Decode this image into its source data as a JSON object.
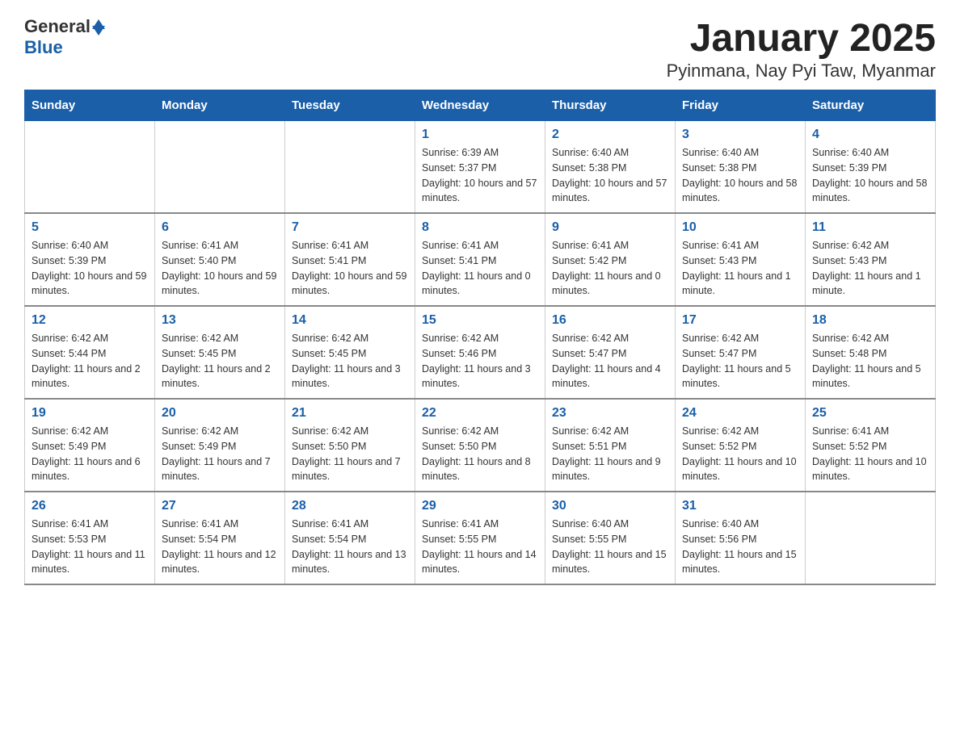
{
  "logo": {
    "text_general": "General",
    "text_blue": "Blue"
  },
  "title": "January 2025",
  "subtitle": "Pyinmana, Nay Pyi Taw, Myanmar",
  "days_of_week": [
    "Sunday",
    "Monday",
    "Tuesday",
    "Wednesday",
    "Thursday",
    "Friday",
    "Saturday"
  ],
  "weeks": [
    [
      {
        "day": "",
        "info": ""
      },
      {
        "day": "",
        "info": ""
      },
      {
        "day": "",
        "info": ""
      },
      {
        "day": "1",
        "info": "Sunrise: 6:39 AM\nSunset: 5:37 PM\nDaylight: 10 hours and 57 minutes."
      },
      {
        "day": "2",
        "info": "Sunrise: 6:40 AM\nSunset: 5:38 PM\nDaylight: 10 hours and 57 minutes."
      },
      {
        "day": "3",
        "info": "Sunrise: 6:40 AM\nSunset: 5:38 PM\nDaylight: 10 hours and 58 minutes."
      },
      {
        "day": "4",
        "info": "Sunrise: 6:40 AM\nSunset: 5:39 PM\nDaylight: 10 hours and 58 minutes."
      }
    ],
    [
      {
        "day": "5",
        "info": "Sunrise: 6:40 AM\nSunset: 5:39 PM\nDaylight: 10 hours and 59 minutes."
      },
      {
        "day": "6",
        "info": "Sunrise: 6:41 AM\nSunset: 5:40 PM\nDaylight: 10 hours and 59 minutes."
      },
      {
        "day": "7",
        "info": "Sunrise: 6:41 AM\nSunset: 5:41 PM\nDaylight: 10 hours and 59 minutes."
      },
      {
        "day": "8",
        "info": "Sunrise: 6:41 AM\nSunset: 5:41 PM\nDaylight: 11 hours and 0 minutes."
      },
      {
        "day": "9",
        "info": "Sunrise: 6:41 AM\nSunset: 5:42 PM\nDaylight: 11 hours and 0 minutes."
      },
      {
        "day": "10",
        "info": "Sunrise: 6:41 AM\nSunset: 5:43 PM\nDaylight: 11 hours and 1 minute."
      },
      {
        "day": "11",
        "info": "Sunrise: 6:42 AM\nSunset: 5:43 PM\nDaylight: 11 hours and 1 minute."
      }
    ],
    [
      {
        "day": "12",
        "info": "Sunrise: 6:42 AM\nSunset: 5:44 PM\nDaylight: 11 hours and 2 minutes."
      },
      {
        "day": "13",
        "info": "Sunrise: 6:42 AM\nSunset: 5:45 PM\nDaylight: 11 hours and 2 minutes."
      },
      {
        "day": "14",
        "info": "Sunrise: 6:42 AM\nSunset: 5:45 PM\nDaylight: 11 hours and 3 minutes."
      },
      {
        "day": "15",
        "info": "Sunrise: 6:42 AM\nSunset: 5:46 PM\nDaylight: 11 hours and 3 minutes."
      },
      {
        "day": "16",
        "info": "Sunrise: 6:42 AM\nSunset: 5:47 PM\nDaylight: 11 hours and 4 minutes."
      },
      {
        "day": "17",
        "info": "Sunrise: 6:42 AM\nSunset: 5:47 PM\nDaylight: 11 hours and 5 minutes."
      },
      {
        "day": "18",
        "info": "Sunrise: 6:42 AM\nSunset: 5:48 PM\nDaylight: 11 hours and 5 minutes."
      }
    ],
    [
      {
        "day": "19",
        "info": "Sunrise: 6:42 AM\nSunset: 5:49 PM\nDaylight: 11 hours and 6 minutes."
      },
      {
        "day": "20",
        "info": "Sunrise: 6:42 AM\nSunset: 5:49 PM\nDaylight: 11 hours and 7 minutes."
      },
      {
        "day": "21",
        "info": "Sunrise: 6:42 AM\nSunset: 5:50 PM\nDaylight: 11 hours and 7 minutes."
      },
      {
        "day": "22",
        "info": "Sunrise: 6:42 AM\nSunset: 5:50 PM\nDaylight: 11 hours and 8 minutes."
      },
      {
        "day": "23",
        "info": "Sunrise: 6:42 AM\nSunset: 5:51 PM\nDaylight: 11 hours and 9 minutes."
      },
      {
        "day": "24",
        "info": "Sunrise: 6:42 AM\nSunset: 5:52 PM\nDaylight: 11 hours and 10 minutes."
      },
      {
        "day": "25",
        "info": "Sunrise: 6:41 AM\nSunset: 5:52 PM\nDaylight: 11 hours and 10 minutes."
      }
    ],
    [
      {
        "day": "26",
        "info": "Sunrise: 6:41 AM\nSunset: 5:53 PM\nDaylight: 11 hours and 11 minutes."
      },
      {
        "day": "27",
        "info": "Sunrise: 6:41 AM\nSunset: 5:54 PM\nDaylight: 11 hours and 12 minutes."
      },
      {
        "day": "28",
        "info": "Sunrise: 6:41 AM\nSunset: 5:54 PM\nDaylight: 11 hours and 13 minutes."
      },
      {
        "day": "29",
        "info": "Sunrise: 6:41 AM\nSunset: 5:55 PM\nDaylight: 11 hours and 14 minutes."
      },
      {
        "day": "30",
        "info": "Sunrise: 6:40 AM\nSunset: 5:55 PM\nDaylight: 11 hours and 15 minutes."
      },
      {
        "day": "31",
        "info": "Sunrise: 6:40 AM\nSunset: 5:56 PM\nDaylight: 11 hours and 15 minutes."
      },
      {
        "day": "",
        "info": ""
      }
    ]
  ]
}
